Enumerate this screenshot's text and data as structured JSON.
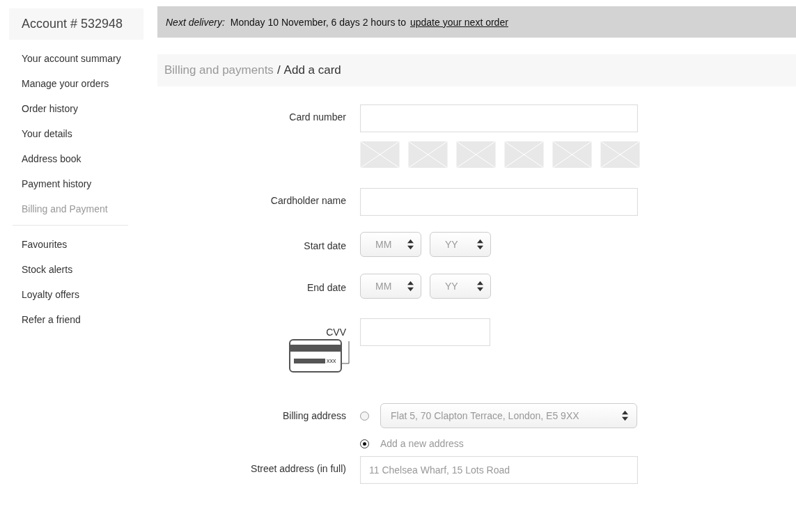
{
  "account": {
    "title": "Account # 532948"
  },
  "sidebar": {
    "groups": [
      [
        {
          "label": "Your account summary",
          "selected": false
        },
        {
          "label": "Manage your orders",
          "selected": false
        },
        {
          "label": "Order history",
          "selected": false
        },
        {
          "label": "Your details",
          "selected": false
        },
        {
          "label": "Address book",
          "selected": false
        },
        {
          "label": "Payment history",
          "selected": false
        },
        {
          "label": "Billing and Payment",
          "selected": true
        }
      ],
      [
        {
          "label": "Favourites",
          "selected": false
        },
        {
          "label": "Stock alerts",
          "selected": false
        },
        {
          "label": "Loyalty offers",
          "selected": false
        },
        {
          "label": "Refer a friend",
          "selected": false
        }
      ]
    ]
  },
  "delivery_bar": {
    "label": "Next delivery:",
    "text": "Monday 10 November, 6 days 2 hours to",
    "link": "update your next order"
  },
  "breadcrumb": {
    "parent": "Billing and payments",
    "separator": "/",
    "current": "Add a card"
  },
  "form": {
    "card_number": {
      "label": "Card number"
    },
    "cardholder_name": {
      "label": "Cardholder name"
    },
    "start_date": {
      "label": "Start date",
      "month_placeholder": "MM",
      "year_placeholder": "YY"
    },
    "end_date": {
      "label": "End date",
      "month_placeholder": "MM",
      "year_placeholder": "YY"
    },
    "cvv": {
      "label": "CVV",
      "illustration_text": "xxx"
    },
    "billing_address": {
      "label": "Billing address",
      "options": [
        {
          "label": "Flat 5, 70 Clapton Terrace, London, E5 9XX",
          "kind": "select",
          "selected": false
        },
        {
          "label": "Add a new address",
          "kind": "text",
          "selected": true
        }
      ]
    },
    "street_address": {
      "label": "Street address (in full)",
      "placeholder": "11 Chelsea Wharf, 15 Lots Road"
    }
  }
}
